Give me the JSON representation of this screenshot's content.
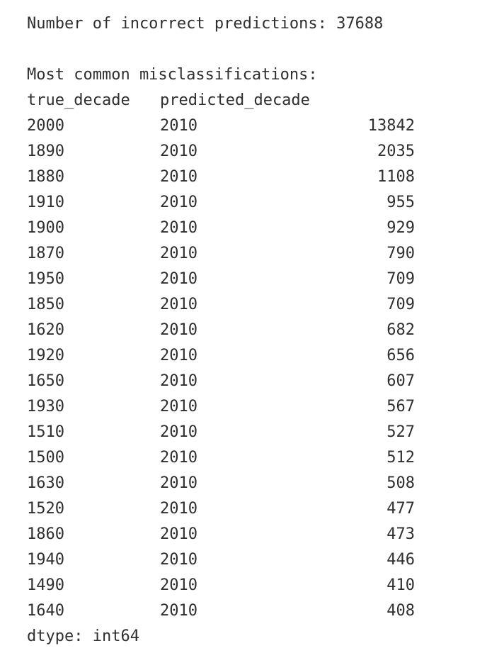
{
  "summary": {
    "incorrect_label": "Number of incorrect predictions: 37688",
    "section_title": "Most common misclassifications:",
    "dtype_label": "dtype: int64"
  },
  "table": {
    "headers": [
      "true_decade",
      "predicted_decade"
    ],
    "rows": [
      [
        "2000",
        "2010",
        "13842"
      ],
      [
        "1890",
        "2010",
        "2035"
      ],
      [
        "1880",
        "2010",
        "1108"
      ],
      [
        "1910",
        "2010",
        "955"
      ],
      [
        "1900",
        "2010",
        "929"
      ],
      [
        "1870",
        "2010",
        "790"
      ],
      [
        "1950",
        "2010",
        "709"
      ],
      [
        "1850",
        "2010",
        "709"
      ],
      [
        "1620",
        "2010",
        "682"
      ],
      [
        "1920",
        "2010",
        "656"
      ],
      [
        "1650",
        "2010",
        "607"
      ],
      [
        "1930",
        "2010",
        "567"
      ],
      [
        "1510",
        "2010",
        "527"
      ],
      [
        "1500",
        "2010",
        "512"
      ],
      [
        "1630",
        "2010",
        "508"
      ],
      [
        "1520",
        "2010",
        "477"
      ],
      [
        "1860",
        "2010",
        "473"
      ],
      [
        "1940",
        "2010",
        "446"
      ],
      [
        "1490",
        "2010",
        "410"
      ],
      [
        "1640",
        "2010",
        "408"
      ]
    ]
  }
}
